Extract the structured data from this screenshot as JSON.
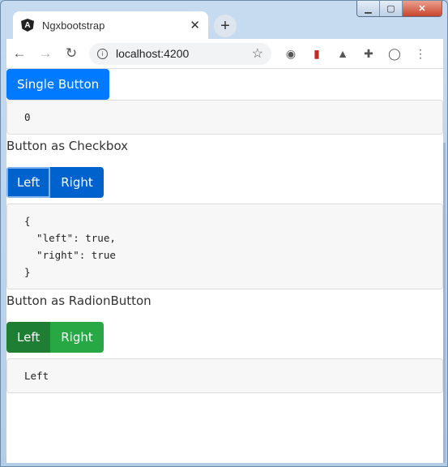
{
  "browser": {
    "tab_title": "Ngxbootstrap",
    "url": "localhost:4200"
  },
  "single": {
    "button_label": "Single Button",
    "value": "0"
  },
  "checkbox": {
    "heading": "Button as Checkbox",
    "left_label": "Left",
    "right_label": "Right",
    "value": "{\n  \"left\": true,\n  \"right\": true\n}"
  },
  "radio": {
    "heading": "Button as RadionButton",
    "left_label": "Left",
    "right_label": "Right",
    "value": "Left"
  },
  "colors": {
    "primary": "#007bff",
    "primary_active": "#0062cc",
    "success": "#28a745",
    "success_active": "#1e7e34"
  }
}
